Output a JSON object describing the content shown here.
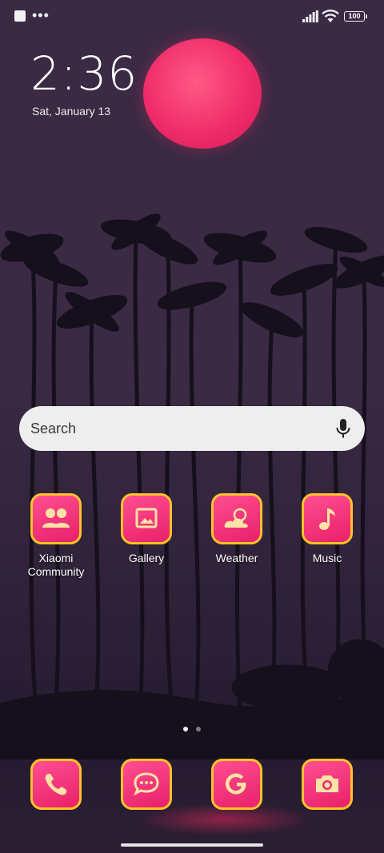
{
  "status_bar": {
    "left_icons": [
      "square-notification-icon",
      "more-dots-icon"
    ],
    "battery_level": "100",
    "right_icons": [
      "signal-icon",
      "wifi-icon",
      "battery-icon"
    ]
  },
  "lockclock": {
    "time": "2:36",
    "date": "Sat, January 13"
  },
  "search": {
    "placeholder": "Search",
    "icon": "microphone-icon"
  },
  "apps": [
    {
      "label_line1": "Xiaomi",
      "label_line2": "Community",
      "icon": "community-icon"
    },
    {
      "label_line1": "Gallery",
      "label_line2": "",
      "icon": "gallery-icon"
    },
    {
      "label_line1": "Weather",
      "label_line2": "",
      "icon": "weather-icon"
    },
    {
      "label_line1": "Music",
      "label_line2": "",
      "icon": "music-icon"
    }
  ],
  "page_indicator": {
    "count": 2,
    "active": 0
  },
  "dock": [
    {
      "icon": "phone-icon"
    },
    {
      "icon": "messages-icon"
    },
    {
      "icon": "google-icon"
    },
    {
      "icon": "camera-icon"
    }
  ],
  "colors": {
    "app_gradient_top": "#ff4f90",
    "app_gradient_bottom": "#e8206a",
    "app_border": "#ffc22a",
    "icon_glyph": "#ffe3a6",
    "sun": "#f02d6a"
  }
}
